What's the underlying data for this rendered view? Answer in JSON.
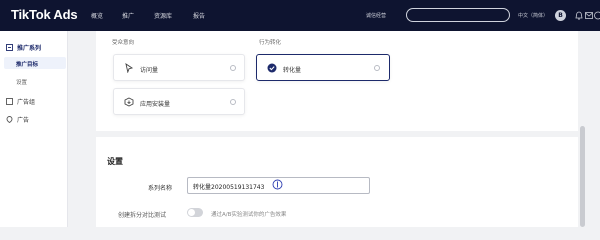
{
  "header": {
    "logo": "TikTok Ads",
    "nav": [
      "概览",
      "推广",
      "资源库",
      "报告"
    ],
    "account_label": "诚信经营",
    "search_placeholder": "",
    "language": "中文（简体）",
    "avatar_letter": "B"
  },
  "sidebar": {
    "group1": "推广系列",
    "sub_active": "推广目标",
    "sub2": "设置",
    "group2": "广告组",
    "group3": "广告"
  },
  "objectives": {
    "group1_label": "受众意向",
    "group2_label": "行为转化",
    "traffic": "访问量",
    "app_install": "应用安装量",
    "conversions": "转化量"
  },
  "settings": {
    "title": "设置",
    "campaign_name_label": "系列名称",
    "campaign_name_value": "转化量20200519131743",
    "ab_test_label": "创建拆分对比测试",
    "ab_test_desc": "通过A/B实验测试你的广告效果"
  },
  "colors": {
    "topbar": "#0e1430",
    "accent": "#1d2a6b"
  }
}
